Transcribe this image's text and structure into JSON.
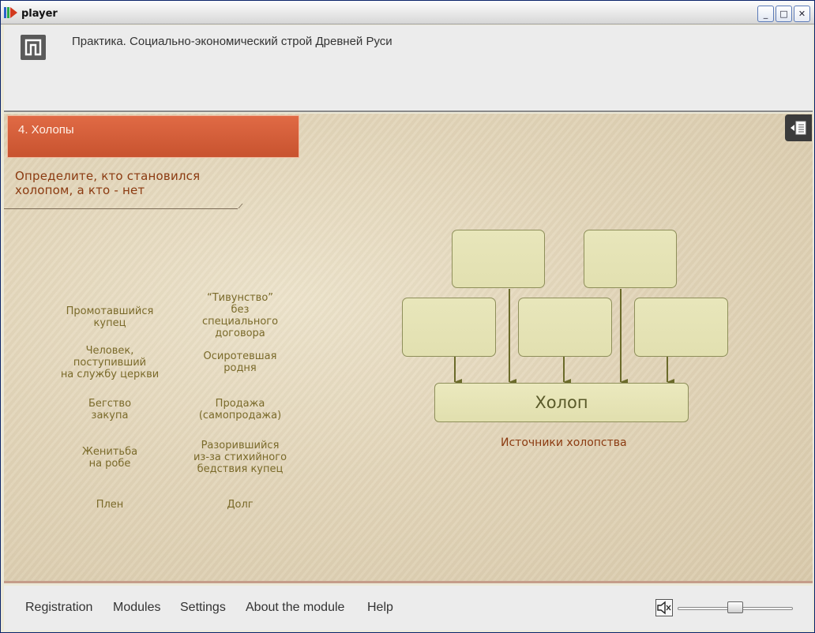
{
  "window": {
    "title": "player",
    "controls": {
      "minimize": "_",
      "maximize": "□",
      "close": "✕"
    }
  },
  "header": {
    "logo_icon": "pi-logo-icon",
    "title": "Практика. Социально-экономический строй Древней Руси"
  },
  "lesson": {
    "topic": "4. Холопы",
    "instruction_line1": "Определите, кто становился",
    "instruction_line2": "холопом, а кто - нет",
    "menu_icon": "list-menu-icon"
  },
  "items_left": [
    {
      "l1": "Промотавшийся",
      "l2": "купец",
      "l3": ""
    },
    {
      "l1": "Человек,",
      "l2": "поступивший",
      "l3": "на службу церкви"
    },
    {
      "l1": "Бегство",
      "l2": "закупа",
      "l3": ""
    },
    {
      "l1": "Женитьба",
      "l2": "на робе",
      "l3": ""
    },
    {
      "l1": "Плен",
      "l2": "",
      "l3": ""
    }
  ],
  "items_right": [
    {
      "l1": "“Тивунство”",
      "l2": "без",
      "l3": "специального",
      "l4": "договора"
    },
    {
      "l1": "Осиротевшая",
      "l2": "родня",
      "l3": "",
      "l4": ""
    },
    {
      "l1": "Продажа",
      "l2": "(самопродажа)",
      "l3": "",
      "l4": ""
    },
    {
      "l1": "Разорившийся",
      "l2": "из-за стихийного",
      "l3": "бедствия купец",
      "l4": ""
    },
    {
      "l1": "Долг",
      "l2": "",
      "l3": "",
      "l4": ""
    }
  ],
  "diagram": {
    "result_label": "Холоп",
    "caption": "Источники холопства",
    "slot_color": "#e6e4b6",
    "arrow_color": "#6b6b2a"
  },
  "footer": {
    "nav": [
      "Registration",
      "Modules",
      "Settings",
      "About the module",
      "Help"
    ],
    "speaker_icon": "speaker-muted-icon",
    "volume_fraction": 0.5
  }
}
